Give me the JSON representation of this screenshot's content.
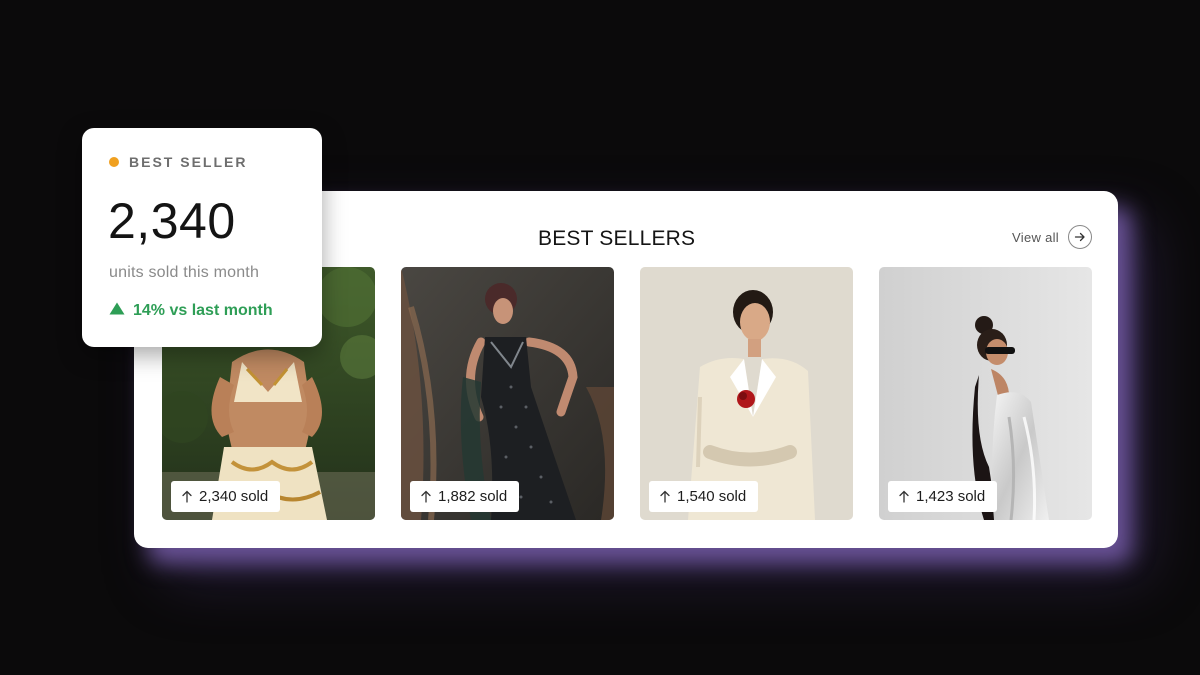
{
  "panel": {
    "title": "BEST SELLERS",
    "view_all_label": "View all",
    "view_all_icon": "arrow-right-icon"
  },
  "products": [
    {
      "sold": "2,340 sold",
      "icon": "arrow-up-icon"
    },
    {
      "sold": "1,882 sold",
      "icon": "arrow-up-icon"
    },
    {
      "sold": "1,540 sold",
      "icon": "arrow-up-icon"
    },
    {
      "sold": "1,423 sold",
      "icon": "arrow-up-icon"
    }
  ],
  "stat_card": {
    "tag": "BEST SELLER",
    "value": "2,340",
    "subtitle": "units sold this month",
    "delta": "14% vs last month",
    "delta_icon": "triangle-up-icon"
  },
  "colors": {
    "background": "#0b0a0b",
    "accent_glow": "#765ca8",
    "tag_dot": "#f0a020",
    "positive": "#2e9e56"
  }
}
